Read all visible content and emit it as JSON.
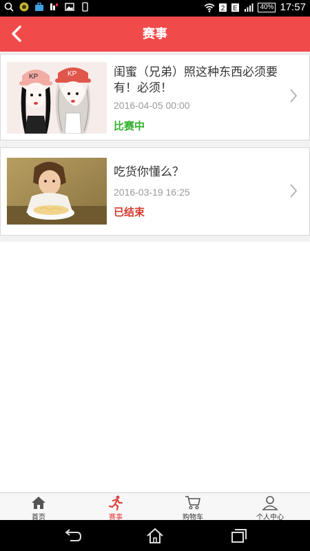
{
  "status_bar": {
    "time": "17:57",
    "battery": "40%"
  },
  "header": {
    "title": "赛事",
    "back_icon": "chevron-left-icon"
  },
  "events": [
    {
      "title": "闺蜜（兄弟）照这种东西必须要有！必须！",
      "date": "2016-04-05 00:00",
      "status": "比赛中",
      "status_color": "#2fb12a"
    },
    {
      "title": "吃货你懂么？",
      "date": "2016-03-19 16:25",
      "status": "已结束",
      "status_color": "#d23a2e"
    }
  ],
  "tabs": [
    {
      "label": "首页",
      "icon": "home-icon"
    },
    {
      "label": "赛事",
      "icon": "runner-icon",
      "active": true
    },
    {
      "label": "购物车",
      "icon": "cart-icon"
    },
    {
      "label": "个人中心",
      "icon": "person-icon"
    }
  ],
  "colors": {
    "header_bg": "#f14a4a",
    "active_tab": "#e64040"
  }
}
